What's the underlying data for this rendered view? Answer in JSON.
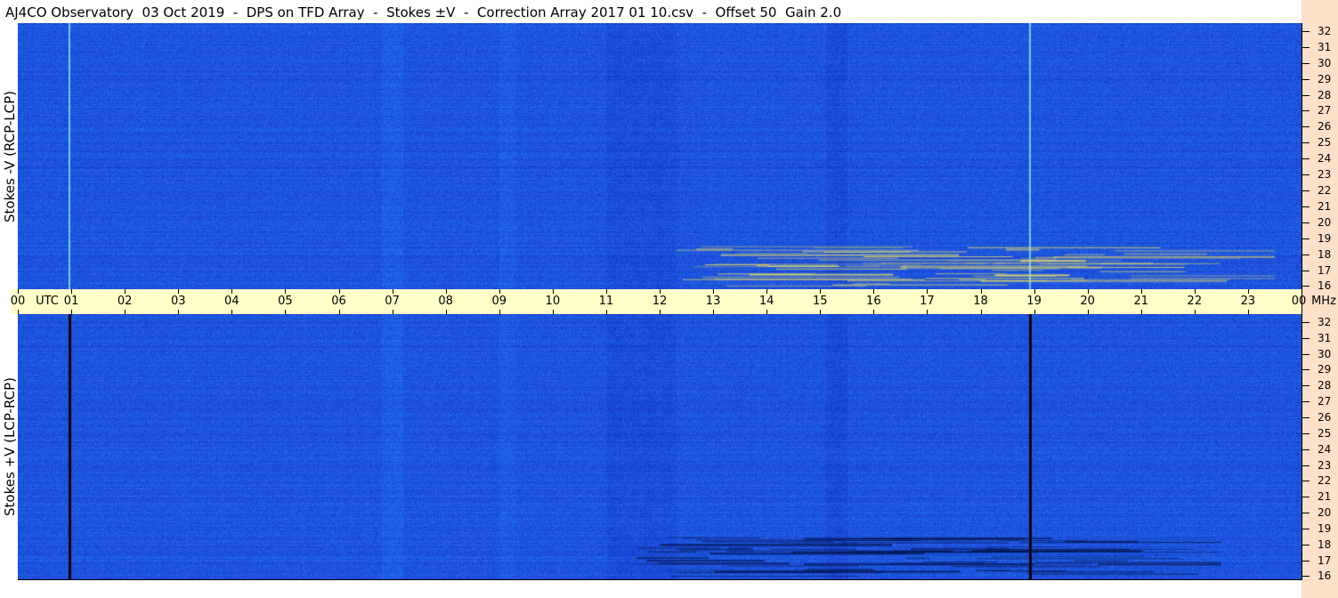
{
  "header": {
    "title": "AJ4CO Observatory  03 Oct 2019  -  DPS on TFD Array  -  Stokes ±V  -  Correction Array 2017 01 10.csv  -  Offset 50  Gain 2.0"
  },
  "chart_data": [
    {
      "type": "heatmap",
      "panel": "top",
      "ylabel": "Stokes -V (RCP-LCP)",
      "x_unit": "UTC",
      "y_unit": "MHz",
      "xlim": [
        0,
        24
      ],
      "ylim": [
        15.8,
        32.5
      ],
      "x_tick_labels": [
        "00",
        "01",
        "02",
        "03",
        "04",
        "05",
        "06",
        "07",
        "08",
        "09",
        "10",
        "11",
        "12",
        "13",
        "14",
        "15",
        "16",
        "17",
        "18",
        "19",
        "20",
        "21",
        "22",
        "23",
        "00"
      ],
      "y_tick_labels": [
        "16",
        "17",
        "18",
        "19",
        "20",
        "21",
        "22",
        "23",
        "24",
        "25",
        "26",
        "27",
        "28",
        "29",
        "30",
        "31",
        "32"
      ],
      "background_color": "#1d55dd",
      "features": [
        {
          "kind": "vertical_line",
          "utc": 0.95,
          "color": "#6ec8ff"
        },
        {
          "kind": "vertical_line",
          "utc": 18.9,
          "color": "#6ec8ff"
        },
        {
          "kind": "emission_band",
          "utc_start": 11.5,
          "utc_end": 23.5,
          "mhz_start": 16.0,
          "mhz_end": 18.5,
          "color": "#f0e060"
        }
      ]
    },
    {
      "type": "heatmap",
      "panel": "bottom",
      "ylabel": "Stokes +V (LCP-RCP)",
      "x_unit": "UTC",
      "y_unit": "MHz",
      "xlim": [
        0,
        24
      ],
      "ylim": [
        15.8,
        32.5
      ],
      "x_tick_labels": [
        "00",
        "01",
        "02",
        "03",
        "04",
        "05",
        "06",
        "07",
        "08",
        "09",
        "10",
        "11",
        "12",
        "13",
        "14",
        "15",
        "16",
        "17",
        "18",
        "19",
        "20",
        "21",
        "22",
        "23",
        "00"
      ],
      "y_tick_labels": [
        "16",
        "17",
        "18",
        "19",
        "20",
        "21",
        "22",
        "23",
        "24",
        "25",
        "26",
        "27",
        "28",
        "29",
        "30",
        "31",
        "32"
      ],
      "background_color": "#1d55dd",
      "features": [
        {
          "kind": "vertical_line",
          "utc": 0.95,
          "color": "#000000"
        },
        {
          "kind": "vertical_line",
          "utc": 18.9,
          "color": "#000000"
        },
        {
          "kind": "emission_band",
          "utc_start": 11.5,
          "utc_end": 22.5,
          "mhz_start": 16.0,
          "mhz_end": 18.5,
          "color": "#001040"
        }
      ]
    }
  ],
  "axis": {
    "x_utc_label": "UTC",
    "y_unit_label": "MHz"
  }
}
